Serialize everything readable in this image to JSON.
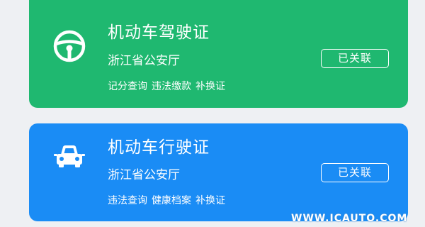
{
  "cards": [
    {
      "icon": "steering-wheel-icon",
      "title": "机动车驾驶证",
      "issuer": "浙江省公安厅",
      "status_label": "已关联",
      "services": [
        "记分查询",
        "违法缴款",
        "补换证"
      ],
      "color": "#1fb870"
    },
    {
      "icon": "car-icon",
      "title": "机动车行驶证",
      "issuer": "浙江省公安厅",
      "status_label": "已关联",
      "services": [
        "违法查询",
        "健康档案",
        "补换证"
      ],
      "color": "#1a8cf5"
    }
  ],
  "watermark": "WWW.ICAUTO.COM"
}
